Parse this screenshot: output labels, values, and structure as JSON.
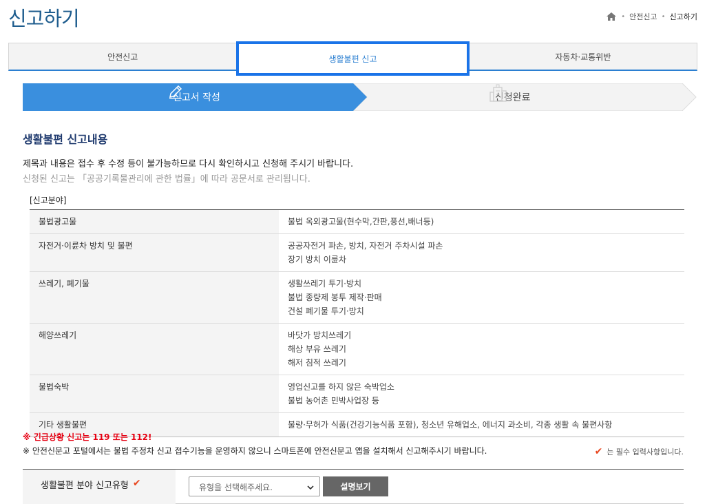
{
  "page": {
    "title": "신고하기"
  },
  "breadcrumb": {
    "items": [
      "안전신고",
      "신고하기"
    ]
  },
  "tabs": [
    {
      "label": "안전신고"
    },
    {
      "label": "생활불편 신고"
    },
    {
      "label": "자동차·교통위반"
    }
  ],
  "steps": [
    {
      "label": "신고서 작성",
      "icon": "pencil-icon"
    },
    {
      "label": "신청완료",
      "icon": "building-icon"
    }
  ],
  "content": {
    "section_title": "생활불편 신고내용",
    "notice_main": "제목과 내용은 접수 후 수정 등이 불가능하므로 다시 확인하시고 신청해 주시기 바랍니다.",
    "notice_sub": "신청된 신고는 「공공기록물관리에 관한 법률」에 따라 공문서로 관리됩니다.",
    "field_label": "[신고분야]"
  },
  "categories": [
    {
      "name": "불법광고물",
      "lines": [
        "불법 옥외광고물(현수막,간판,풍선,배너등)"
      ]
    },
    {
      "name": "자전거·이륜차 방치 및 불편",
      "lines": [
        "공공자전거 파손, 방치, 자전거 주차시설 파손",
        "장기 방치 이륜차"
      ]
    },
    {
      "name": "쓰레기, 폐기물",
      "lines": [
        "생활쓰레기 투기·방치",
        "불법 종량제 봉투 제작·판매",
        "건설 폐기물 투기·방치"
      ]
    },
    {
      "name": "해양쓰레기",
      "lines": [
        "바닷가 방치쓰레기",
        "해상 부유 쓰레기",
        "해저 침적 쓰레기"
      ]
    },
    {
      "name": "불법숙박",
      "lines": [
        "영업신고를 하지 않은 숙박업소",
        "불법 농어촌 민박사업장 등"
      ]
    },
    {
      "name": "기타 생활불편",
      "lines": [
        "불량·무허가 식품(건강기능식품 포함), 청소년 유해업소, 에너지 과소비, 각종 생활 속 불편사항"
      ]
    }
  ],
  "notes": {
    "emergency": "※ 긴급상황 신고는 119 또는 112!",
    "portal": "※ 안전신문고 포털에서는 불법 주정차 신고 접수기능을 운영하지 않으니 스마트폰에 안전신문고 앱을 설치해서 신고해주시기 바랍니다.",
    "required": "는 필수 입력사항입니다."
  },
  "form": {
    "type_label": "생활불편 분야 신고유형",
    "select_value": "유형을 선택해주세요.",
    "explain_button": "설명보기"
  },
  "colors": {
    "accent": "#2b7fd1",
    "active_tab_border": "#1a73e8",
    "step_active": "#3a8fde",
    "emergency": "#e60012",
    "required_check": "#e8461e"
  }
}
